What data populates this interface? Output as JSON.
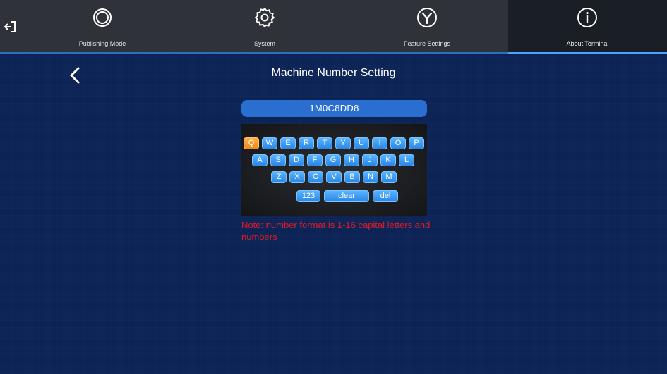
{
  "nav": {
    "tabs": [
      {
        "label": "Publishing Mode",
        "icon": "publishing-mode-icon"
      },
      {
        "label": "System",
        "icon": "gear-icon"
      },
      {
        "label": "Feature Settings",
        "icon": "feature-settings-icon"
      },
      {
        "label": "About Terminal",
        "icon": "info-icon",
        "active": true
      }
    ],
    "exit_icon": "exit-icon"
  },
  "page": {
    "title": "Machine Number Setting",
    "machine_number": "1M0C8DD8",
    "note": "Note: number format is 1-16 capital letters and numbers"
  },
  "keyboard": {
    "row1": [
      "Q",
      "W",
      "E",
      "R",
      "T",
      "Y",
      "U",
      "I",
      "O",
      "P"
    ],
    "row2": [
      "A",
      "S",
      "D",
      "F",
      "G",
      "H",
      "J",
      "K",
      "L"
    ],
    "row3": [
      "Z",
      "X",
      "C",
      "V",
      "B",
      "N",
      "M"
    ],
    "row4": [
      "123",
      "clear",
      "del"
    ],
    "active_key": "Q"
  },
  "colors": {
    "background": "#0c2458",
    "accent": "#2a6fd0",
    "key": "#3a9cf5",
    "key_active": "#f28c1e",
    "note": "#e01b24"
  }
}
